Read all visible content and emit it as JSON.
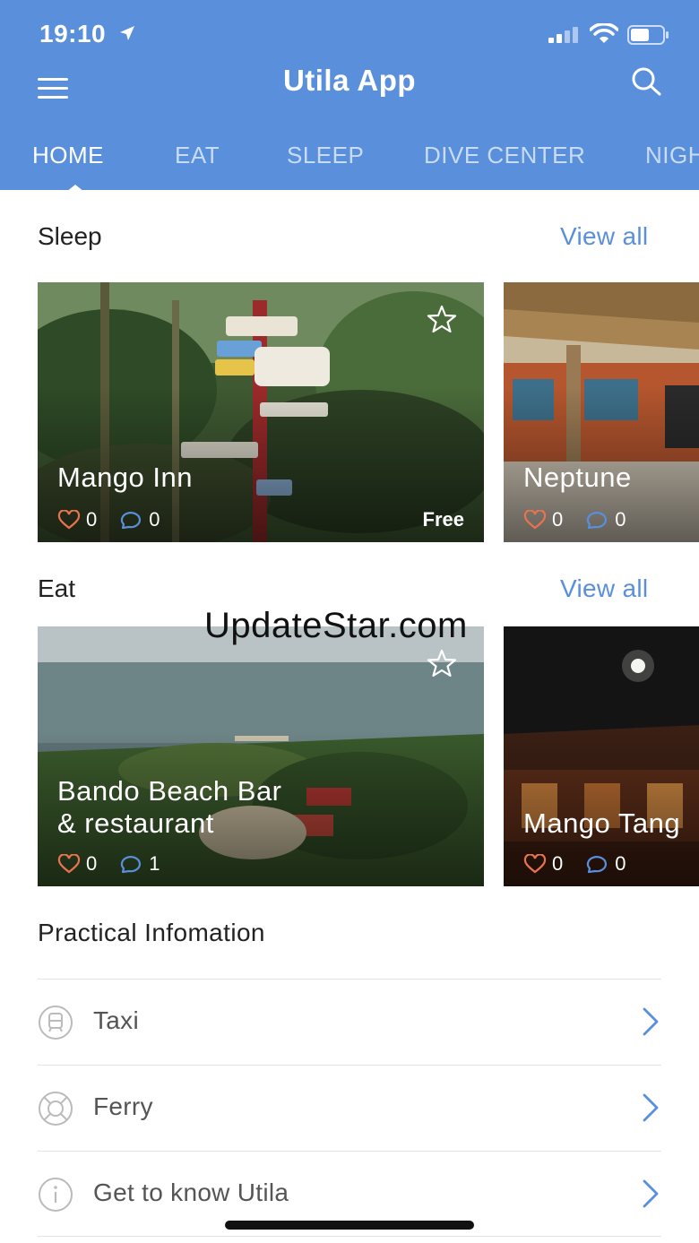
{
  "status_bar": {
    "time": "19:10"
  },
  "header": {
    "title": "Utila App"
  },
  "tabs": [
    {
      "label": "HOME",
      "active": true
    },
    {
      "label": "EAT"
    },
    {
      "label": "SLEEP"
    },
    {
      "label": "DIVE CENTER"
    },
    {
      "label": "NIGH"
    }
  ],
  "sleep": {
    "title": "Sleep",
    "view_all": "View all",
    "cards": [
      {
        "name": "Mango Inn",
        "likes": "0",
        "comments": "0",
        "price": "Free"
      },
      {
        "name": "Neptune",
        "likes": "0",
        "comments": "0"
      }
    ]
  },
  "eat": {
    "title": "Eat",
    "view_all": "View all",
    "cards": [
      {
        "name_line1": "Bando Beach Bar",
        "name_line2": "& restaurant",
        "likes": "0",
        "comments": "1"
      },
      {
        "name": "Mango Tang",
        "likes": "0",
        "comments": "0"
      }
    ]
  },
  "practical": {
    "title": "Practical Infomation",
    "items": [
      {
        "label": "Taxi",
        "icon": "train-icon"
      },
      {
        "label": "Ferry",
        "icon": "lifebuoy-icon"
      },
      {
        "label": "Get to know Utila",
        "icon": "info-icon"
      }
    ]
  },
  "watermark": "UpdateStar.com",
  "colors": {
    "primary": "#5a8fdc",
    "heart": "#e8734f",
    "comment": "#5a8fdc"
  }
}
